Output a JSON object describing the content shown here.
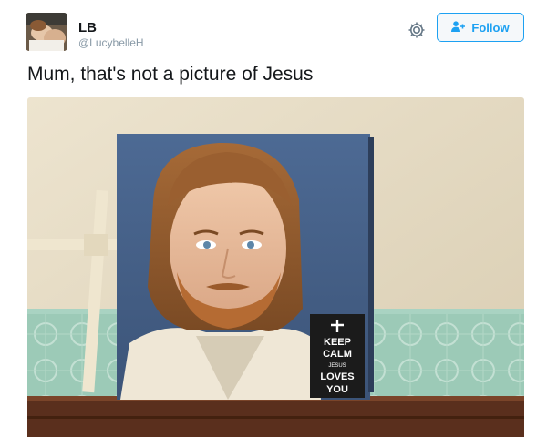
{
  "tweet": {
    "display_name": "LB",
    "handle": "@LucybelleH",
    "follow_label": "Follow",
    "text": "Mum, that's not a picture of Jesus"
  },
  "icons": {
    "settings": "gear-icon",
    "follow": "add-user-icon",
    "cross": "cross-icon"
  },
  "photo": {
    "poster_text": {
      "line1": "KEEP",
      "line2": "CALM",
      "line3": "JESUS",
      "line4": "LOVES",
      "line5": "YOU"
    }
  },
  "colors": {
    "accent": "#1da1f2",
    "muted": "#8899a6",
    "text": "#14171a"
  }
}
